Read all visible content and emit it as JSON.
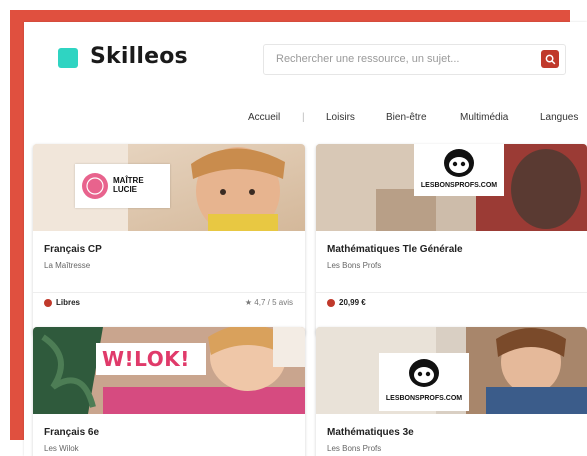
{
  "brand": {
    "name": "Skilleos",
    "accent": "#2fd4c2",
    "frame_color": "#e0503f"
  },
  "search": {
    "placeholder": "Rechercher une ressource, un sujet..."
  },
  "nav": {
    "items": [
      "Accueil",
      "|",
      "Loisirs",
      "Bien-être",
      "Multimédia",
      "Langues"
    ]
  },
  "courses": [
    {
      "title": "Français CP",
      "author": "La Maîtresse",
      "price": "Libres",
      "rating": "★ 4,7 / 5 avis",
      "logo": "MAÎTRE LUCIE",
      "logo_icon": "stamp-badge"
    },
    {
      "title": "Mathématiques Tle Générale",
      "author": "Les Bons Profs",
      "price": "20,99 €",
      "rating": "",
      "logo": "LESBONSPROFS.COM",
      "logo_icon": "teacher-owl"
    },
    {
      "title": "Français 6e",
      "author": "Les Wilok",
      "price": "",
      "rating": "",
      "logo": "W!LOK!",
      "logo_icon": ""
    },
    {
      "title": "Mathématiques 3e",
      "author": "Les Bons Profs",
      "price": "",
      "rating": "",
      "logo": "LESBONSPROFS.COM",
      "logo_icon": "teacher-owl"
    }
  ]
}
